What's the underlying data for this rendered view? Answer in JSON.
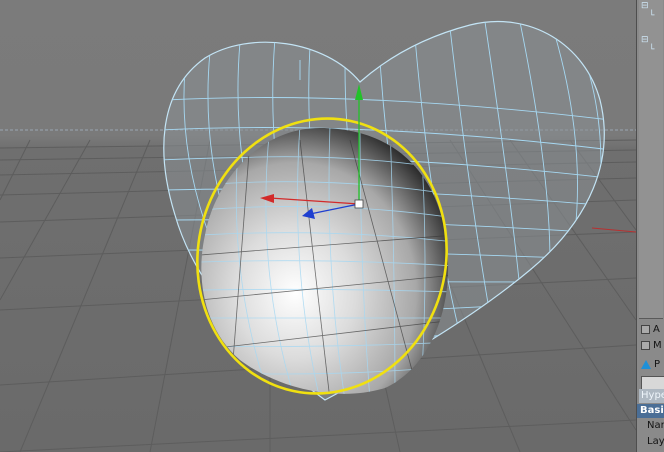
{
  "viewport": {
    "axis_colors": {
      "x": "#d22a2a",
      "y": "#22c22a",
      "z": "#1f3fd0"
    },
    "wireframe_color": "#a6d8f2",
    "selection_ring_color": "#f0e010"
  },
  "attributes": {
    "row1_label": "A",
    "row2_label": "M",
    "object_label": "P",
    "tab_label": "Hype",
    "section_label": "Basi",
    "field_name_label": "Nar",
    "field_layer_label": "Lay"
  }
}
